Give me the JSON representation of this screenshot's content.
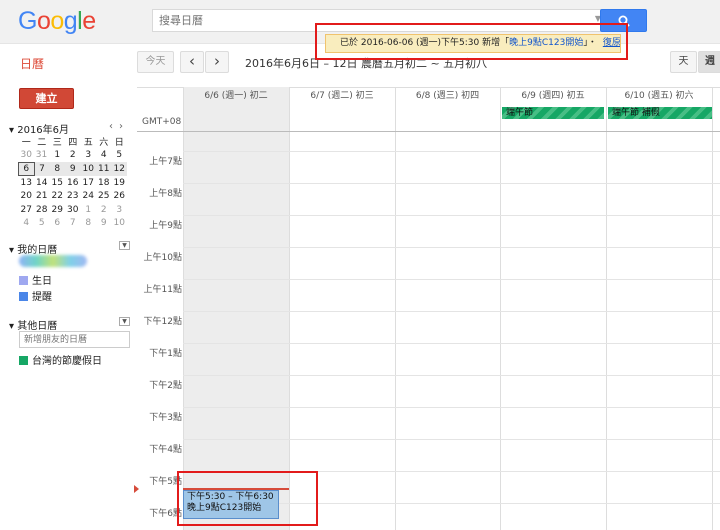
{
  "header": {
    "logo": [
      "G",
      "o",
      "o",
      "g",
      "l",
      "e"
    ],
    "search_placeholder": "搜尋日曆"
  },
  "toolbar": {
    "app_title": "日曆",
    "today_label": "今天",
    "prev_icon": "‹",
    "next_icon": "›",
    "date_range": "2016年6月6日 – 12日 農曆五月初二 ~ 五月初八",
    "view_day": "天",
    "view_week": "週"
  },
  "notice": {
    "prefix": "已於 2016-06-06 (週一)下午5:30 新增「",
    "event_name": "晚上9點C123開始",
    "suffix": "」・",
    "undo_label": "復原"
  },
  "sidebar": {
    "create_label": "建立",
    "mini_cal": {
      "month_title": "2016年6月",
      "weekdays": [
        "一",
        "二",
        "三",
        "四",
        "五",
        "六",
        "日"
      ],
      "weeks": [
        [
          "30",
          "31",
          "1",
          "2",
          "3",
          "4",
          "5"
        ],
        [
          "6",
          "7",
          "8",
          "9",
          "10",
          "11",
          "12"
        ],
        [
          "13",
          "14",
          "15",
          "16",
          "17",
          "18",
          "19"
        ],
        [
          "20",
          "21",
          "22",
          "23",
          "24",
          "25",
          "26"
        ],
        [
          "27",
          "28",
          "29",
          "30",
          "1",
          "2",
          "3"
        ],
        [
          "4",
          "5",
          "6",
          "7",
          "8",
          "9",
          "10"
        ]
      ]
    },
    "my_calendars": {
      "title": "我的日曆",
      "items": [
        {
          "label": "生日",
          "color": "#9fa8f0"
        },
        {
          "label": "提醒",
          "color": "#4a86e8"
        }
      ]
    },
    "other_calendars": {
      "title": "其他日曆",
      "add_friend_placeholder": "新增朋友的日曆",
      "items": [
        {
          "label": "台灣的節慶假日",
          "color": "#16a765"
        }
      ]
    }
  },
  "calendar": {
    "timezone": "GMT+08",
    "days": [
      "6/6 (週一) 初二",
      "6/7 (週二) 初三",
      "6/8 (週三) 初四",
      "6/9 (週四) 初五",
      "6/10 (週五) 初六"
    ],
    "allday_events": [
      {
        "label": "端午節",
        "color": "#16a765"
      },
      {
        "label": "端午節 補假",
        "color": "#16a765"
      }
    ],
    "hours": [
      "上午7點",
      "上午8點",
      "上午9點",
      "上午10點",
      "上午11點",
      "下午12點",
      "下午1點",
      "下午2點",
      "下午3點",
      "下午4點",
      "下午5點",
      "下午6點"
    ],
    "event": {
      "time": "下午5:30 – 下午6:30",
      "title": "晚上9點C123開始",
      "color": "#9fc6e7"
    }
  }
}
